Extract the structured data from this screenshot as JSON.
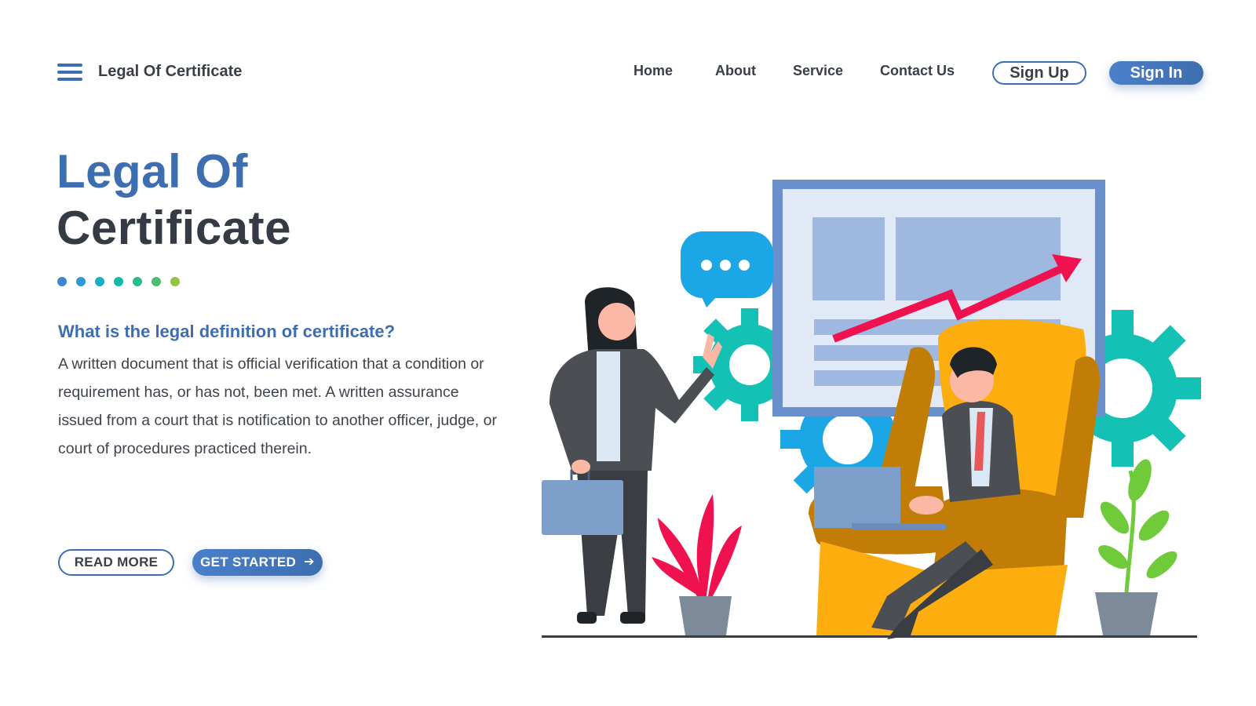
{
  "header": {
    "brand": "Legal Of Certificate",
    "nav": [
      "Home",
      "About",
      "Service",
      "Contact Us"
    ],
    "signup_label": "Sign Up",
    "signin_label": "Sign In"
  },
  "hero": {
    "title_line1": "Legal Of",
    "title_line2": "Certificate",
    "question": "What is the legal definition of certificate?",
    "description": "A written document that is official verification that a condition or requirement has, or has not, been met. A written assurance issued from a court that is notification to another officer, judge, or court of procedures practiced therein.",
    "read_more_label": "READ MORE",
    "get_started_label": "GET STARTED",
    "dot_colors": [
      "#3d86d0",
      "#2a9bd6",
      "#14aec9",
      "#13b9ad",
      "#2bbd86",
      "#4cbf6a",
      "#95c23f"
    ]
  },
  "colors": {
    "primary": "#3d6eb0",
    "text_dark": "#353b44",
    "accent_red": "#f0124f",
    "accent_teal": "#13c2b5",
    "accent_blue": "#1ba7e6",
    "accent_orange": "#fdae0e"
  },
  "icons": {
    "menu": "hamburger-menu-icon",
    "get_started": "arrow-right-icon"
  }
}
